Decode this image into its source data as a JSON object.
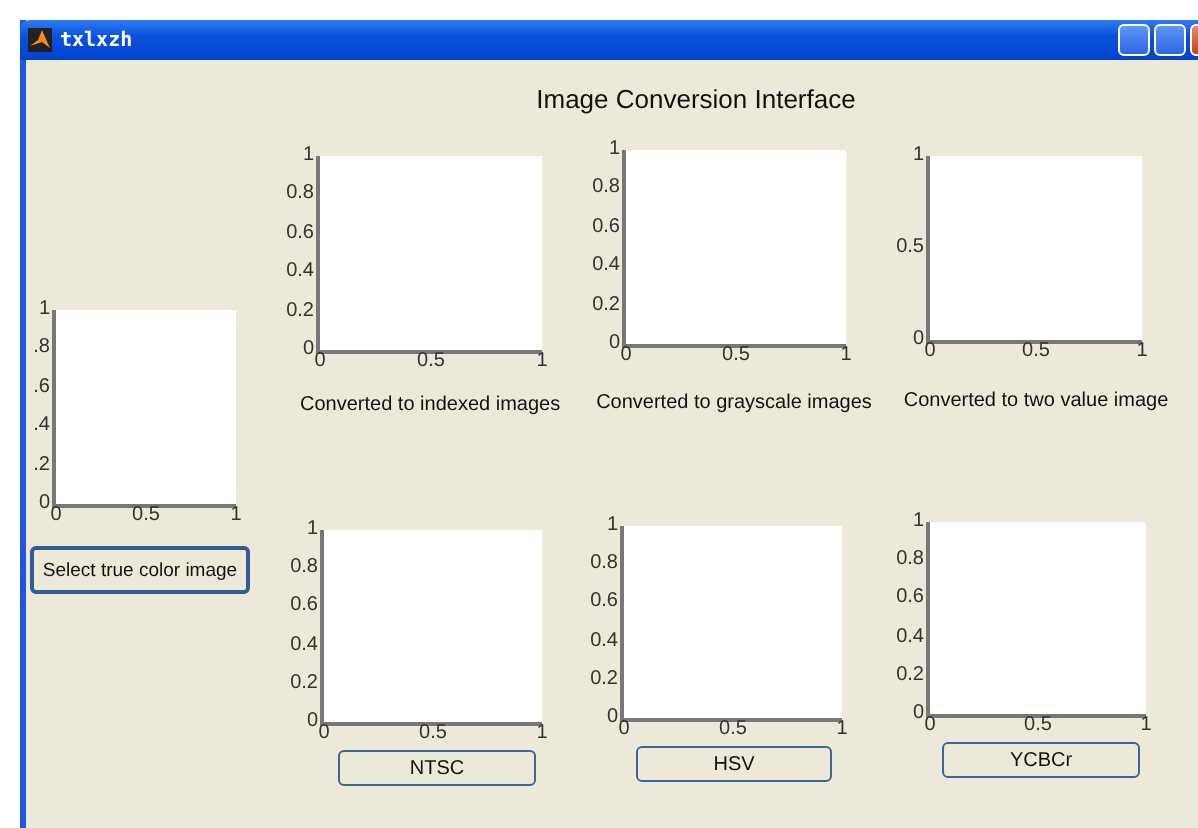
{
  "window": {
    "title": "txlxzh"
  },
  "heading": "Image Conversion Interface",
  "panels": [
    {
      "kind": "button",
      "label": "Select true color image",
      "yticks": [
        "1",
        ".8",
        ".6",
        ".4",
        ".2",
        "0"
      ],
      "xticks": [
        "0",
        "0.5",
        "1"
      ]
    },
    {
      "kind": "caption",
      "label": "Converted to indexed images",
      "yticks": [
        "1",
        "0.8",
        "0.6",
        "0.4",
        "0.2",
        "0"
      ],
      "xticks": [
        "0",
        "0.5",
        "1"
      ]
    },
    {
      "kind": "caption",
      "label": "Converted to grayscale images",
      "yticks": [
        "1",
        "0.8",
        "0.6",
        "0.4",
        "0.2",
        "0"
      ],
      "xticks": [
        "0",
        "0.5",
        "1"
      ]
    },
    {
      "kind": "caption",
      "label": "Converted to two value image",
      "yticks": [
        "1",
        "0.5",
        "0"
      ],
      "xticks": [
        "0",
        "0.5",
        "1"
      ]
    },
    {
      "kind": "button",
      "label": "NTSC",
      "yticks": [
        "1",
        "0.8",
        "0.6",
        "0.4",
        "0.2",
        "0"
      ],
      "xticks": [
        "0",
        "0.5",
        "1"
      ]
    },
    {
      "kind": "button",
      "label": "HSV",
      "yticks": [
        "1",
        "0.8",
        "0.6",
        "0.4",
        "0.2",
        "0"
      ],
      "xticks": [
        "0",
        "0.5",
        "1"
      ]
    },
    {
      "kind": "button",
      "label": "YCBCr",
      "yticks": [
        "1",
        "0.8",
        "0.6",
        "0.4",
        "0.2",
        "0"
      ],
      "xticks": [
        "0",
        "0.5",
        "1"
      ]
    }
  ]
}
